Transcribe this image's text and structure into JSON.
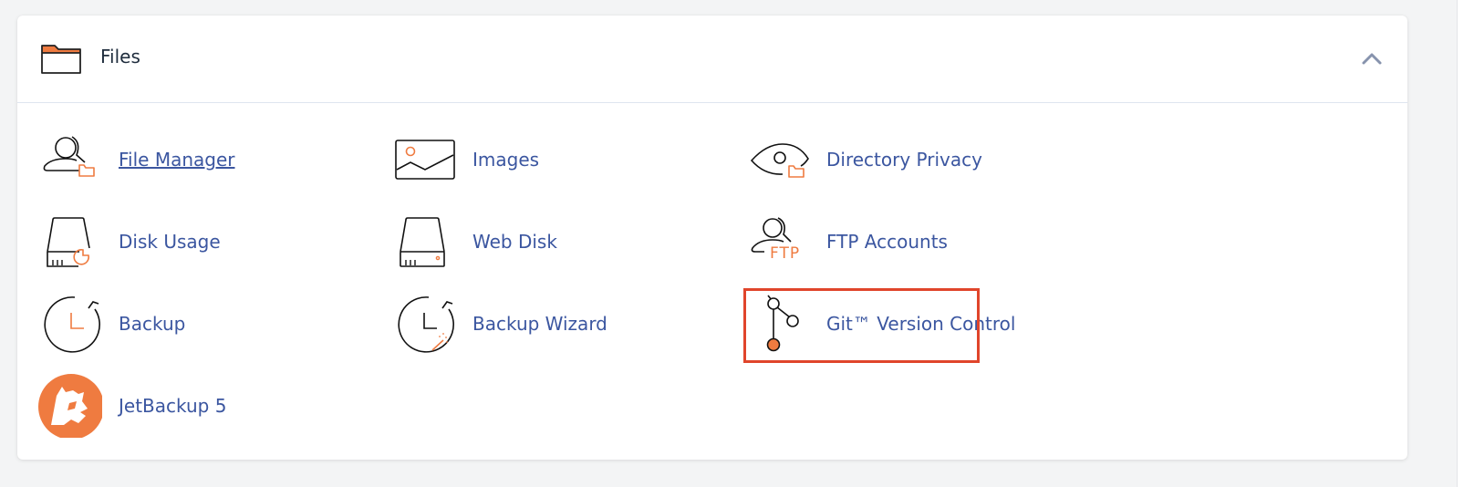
{
  "panel": {
    "title": "Files",
    "collapse_icon": "chevron-up-icon",
    "accent_color": "#ef7b40",
    "link_color": "#3b56a0",
    "highlight_color": "#e0452b"
  },
  "items": [
    {
      "label": "File Manager",
      "icon": "user-folder-icon",
      "hovered": true
    },
    {
      "label": "Images",
      "icon": "image-icon"
    },
    {
      "label": "Directory Privacy",
      "icon": "eye-folder-icon"
    },
    {
      "label": "Disk Usage",
      "icon": "disk-pie-icon"
    },
    {
      "label": "Web Disk",
      "icon": "disk-icon"
    },
    {
      "label": "FTP Accounts",
      "icon": "user-ftp-icon",
      "highlighted": true
    },
    {
      "label": "Backup",
      "icon": "clock-refresh-icon"
    },
    {
      "label": "Backup Wizard",
      "icon": "clock-wand-icon"
    },
    {
      "label": "Git™ Version Control",
      "icon": "git-branch-icon"
    },
    {
      "label": "JetBackup 5",
      "icon": "jetbackup-logo-icon"
    }
  ]
}
